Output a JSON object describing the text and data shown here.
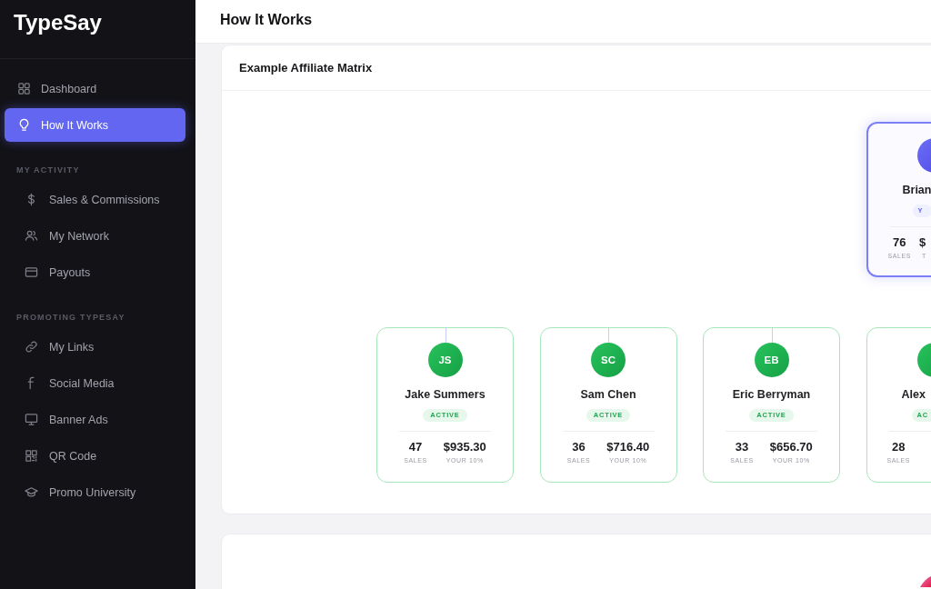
{
  "sidebar": {
    "logo": "TypeSay",
    "items": [
      {
        "label": "Dashboard",
        "selected": false
      },
      {
        "label": "How It Works",
        "selected": true
      }
    ],
    "sections": [
      {
        "title": "MY ACTIVITY",
        "items": [
          {
            "label": "Sales & Commissions",
            "selected": false
          },
          {
            "label": "My Network",
            "selected": false
          },
          {
            "label": "Payouts",
            "selected": false
          }
        ]
      },
      {
        "title": "PROMOTING TYPESAY",
        "items": [
          {
            "label": "My Links",
            "selected": false
          },
          {
            "label": "Social Media",
            "selected": false
          },
          {
            "label": "Banner Ads",
            "selected": false
          },
          {
            "label": "QR Code",
            "selected": false
          },
          {
            "label": "Promo University",
            "selected": false
          }
        ]
      }
    ]
  },
  "header": {
    "title": "How It Works"
  },
  "matrix_card": {
    "title": "Example Affiliate Matrix",
    "root": {
      "kind": "self",
      "name": "Brian",
      "badge": "Y",
      "stats": [
        {
          "value": "76",
          "label": "SALES"
        },
        {
          "value": "$",
          "label": "T"
        }
      ],
      "children": [
        {
          "kind": "affiliate",
          "initials": "JS",
          "name": "Jake Summers",
          "badge": "ACTIVE",
          "stats": [
            {
              "value": "47",
              "label": "SALES"
            },
            {
              "value": "$935.30",
              "label": "YOUR 10%"
            }
          ]
        },
        {
          "kind": "affiliate",
          "initials": "SC",
          "name": "Sam Chen",
          "badge": "ACTIVE",
          "stats": [
            {
              "value": "36",
              "label": "SALES"
            },
            {
              "value": "$716.40",
              "label": "YOUR 10%"
            }
          ]
        },
        {
          "kind": "affiliate",
          "initials": "EB",
          "name": "Eric Berryman",
          "badge": "ACTIVE",
          "stats": [
            {
              "value": "33",
              "label": "SALES"
            },
            {
              "value": "$656.70",
              "label": "YOUR 10%"
            }
          ]
        },
        {
          "kind": "affiliate",
          "name": "Alex",
          "badge": "AC",
          "stats": [
            {
              "value": "28",
              "label": "SALES"
            }
          ]
        }
      ]
    }
  }
}
